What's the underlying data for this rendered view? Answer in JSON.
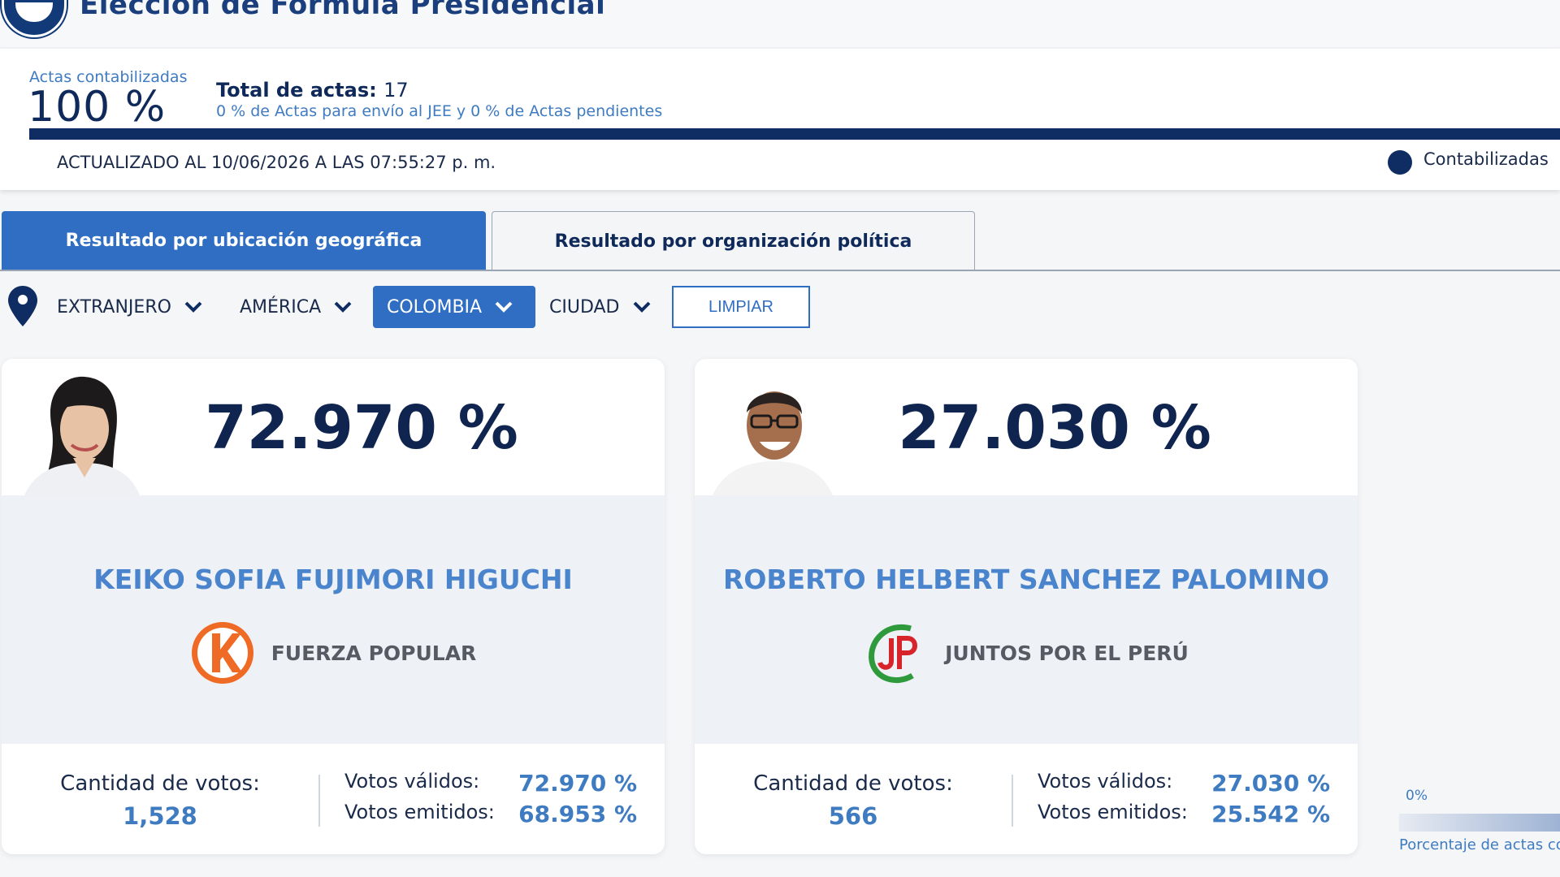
{
  "header": {
    "title": "Elección de Fórmula Presidencial"
  },
  "summary": {
    "actas_label": "Actas contabilizadas",
    "actas_pct": "100 %",
    "actas_progress_fraction": 1.0,
    "total_label": "Total de actas:",
    "total_value": "17",
    "jee_line": "0 % de Actas para envío al JEE y 0 % de Actas pendientes",
    "updated": "ACTUALIZADO AL 10/06/2026 A LAS 07:55:27 p. m.",
    "legend_label": "Contabilizadas"
  },
  "tabs": [
    {
      "label": "Resultado por ubicación geográfica",
      "active": true
    },
    {
      "label": "Resultado por organización política",
      "active": false
    }
  ],
  "filters": {
    "f1": "EXTRANJERO",
    "f2": "AMÉRICA",
    "f3": "COLOMBIA",
    "f4": "CIUDAD",
    "clear_label": "LIMPIAR"
  },
  "candidates": [
    {
      "pct": "72.970 %",
      "name": "KEIKO SOFIA FUJIMORI HIGUCHI",
      "party": "FUERZA POPULAR",
      "party_icon": "fuerza-popular-k-logo",
      "votes_label": "Cantidad de votos:",
      "votes": "1,528",
      "valid_label": "Votos válidos:",
      "valid_pct": "72.970 %",
      "cast_label": "Votos emitidos:",
      "cast_pct": "68.953 %"
    },
    {
      "pct": "27.030 %",
      "name": "ROBERTO HELBERT SANCHEZ PALOMINO",
      "party": "JUNTOS POR EL PERÚ",
      "party_icon": "juntos-por-el-peru-jp-logo",
      "votes_label": "Cantidad de votos:",
      "votes": "566",
      "valid_label": "Votos válidos:",
      "valid_pct": "27.030 %",
      "cast_label": "Votos emitidos:",
      "cast_pct": "25.542 %"
    }
  ],
  "gauge": {
    "zero_label": "0%",
    "caption": "Porcentaje de actas co"
  },
  "colors": {
    "primary_blue": "#2f6ec3",
    "navy": "#0f2d63",
    "accent_light_blue": "#3f7bc1",
    "fuerza_popular_orange": "#ef6a24",
    "jp_green": "#2e9a3c",
    "jp_red": "#d6242a"
  }
}
